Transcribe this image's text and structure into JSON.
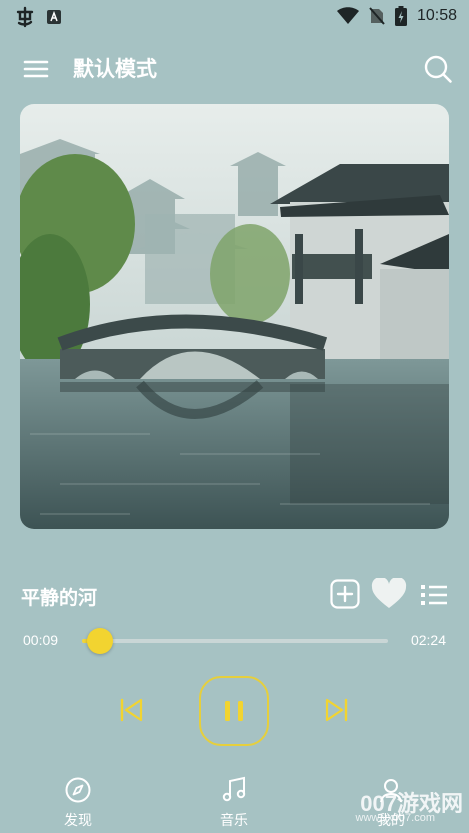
{
  "status_bar": {
    "time": "10:58",
    "left_icons": [
      "app-glyph-icon",
      "a-badge-icon"
    ],
    "right_icons": [
      "wifi-icon",
      "no-sim-icon",
      "battery-charging-icon"
    ]
  },
  "header": {
    "title": "默认模式",
    "menu_icon": "menu-icon",
    "search_icon": "search-icon"
  },
  "cover": {
    "description_icon": "album-cover-art"
  },
  "player": {
    "song_title": "平静的河",
    "current_time": "00:09",
    "total_time": "02:24",
    "progress": 0.06,
    "state": "playing",
    "colors": {
      "accent": "#f2d430",
      "background": "#a6c2c3"
    }
  },
  "nav": {
    "items": [
      {
        "label": "发现",
        "icon": "compass-icon"
      },
      {
        "label": "音乐",
        "icon": "music-note-icon"
      },
      {
        "label": "我的",
        "icon": "profile-icon"
      }
    ]
  },
  "watermark": {
    "main": "007游戏网",
    "sub": "www.yx007.com"
  }
}
